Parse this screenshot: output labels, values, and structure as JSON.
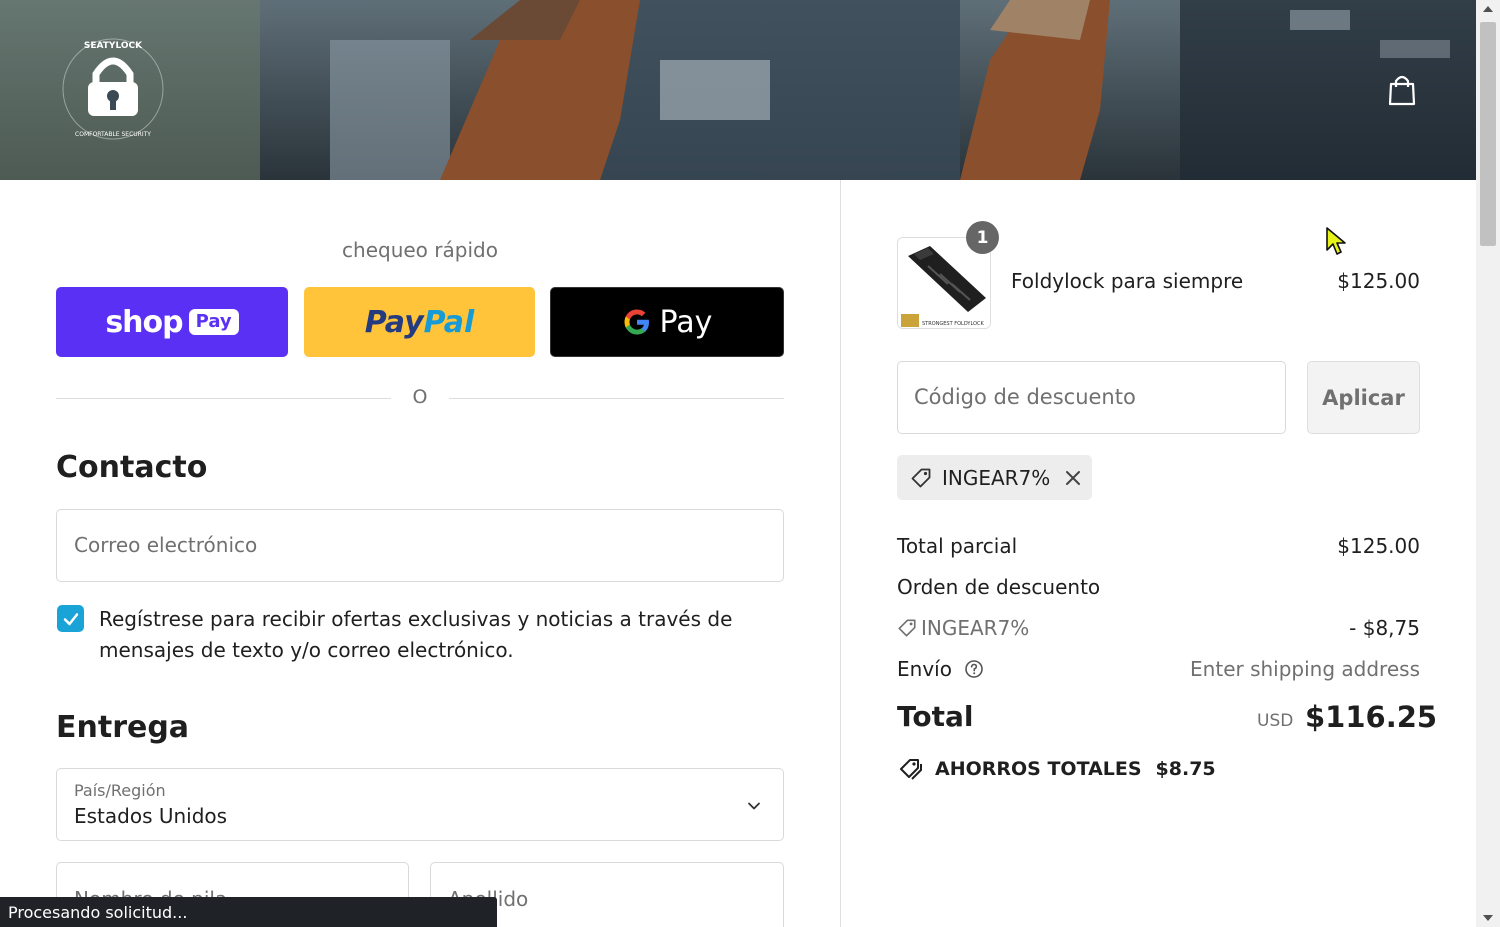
{
  "header": {
    "logo_text_top": "SEATYLOCK",
    "logo_text_bottom": "COMFORTABLE SECURITY",
    "cart_icon": "shopping-bag-icon"
  },
  "express": {
    "title": "chequeo rápido",
    "shop_pay_word": "shop",
    "shop_pay_pill": "Pay",
    "paypal_word_1": "Pay",
    "paypal_word_2": "Pal",
    "gpay_g": "G",
    "gpay_word": "Pay",
    "or": "O"
  },
  "contact": {
    "title": "Contacto",
    "email_placeholder": "Correo electrónico",
    "optin_checked": true,
    "optin_label": "Regístrese para recibir ofertas exclusivas y noticias a través de mensajes de texto y/o correo electrónico."
  },
  "delivery": {
    "title": "Entrega",
    "country_label": "País/Región",
    "country_value": "Estados Unidos",
    "first_name_placeholder": "Nombre de pila",
    "last_name_placeholder": "Apellido"
  },
  "status_bar": "Procesando solicitud...",
  "order": {
    "item": {
      "quantity": "1",
      "name": "Foldylock para siempre",
      "price": "$125.00",
      "thumb_caption": "STRONGEST FOLDYLOCK"
    },
    "discount_placeholder": "Código de descuento",
    "apply_label": "Aplicar",
    "applied_code": "INGEAR7%",
    "subtotal_label": "Total parcial",
    "subtotal_value": "$125.00",
    "order_discount_label": "Orden de descuento",
    "discount_code_label": "INGEAR7%",
    "discount_value": "- $8,75",
    "shipping_label": "Envío",
    "shipping_value": "Enter shipping address",
    "total_label": "Total",
    "total_currency": "USD",
    "total_value": "$116.25",
    "savings_label": "AHORROS TOTALES",
    "savings_value": "$8.75"
  },
  "colors": {
    "shop_pay": "#5a31f4",
    "paypal": "#ffc439",
    "gpay": "#000000",
    "checkbox": "#1aa3d6"
  }
}
